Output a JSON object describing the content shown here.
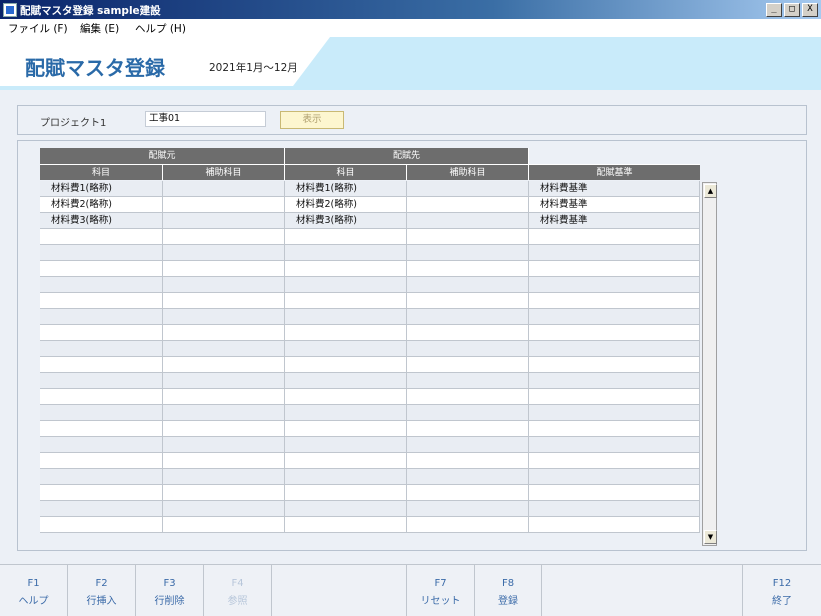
{
  "window": {
    "title": "配賦マスタ登録 sample建設",
    "buttons": [
      "_",
      "□",
      "X"
    ]
  },
  "menu": [
    {
      "label": "ファイル (F)"
    },
    {
      "label": "編集 (E)"
    },
    {
      "label": "ヘルプ (H)"
    }
  ],
  "header": {
    "title": "配賦マスタ登録",
    "period": "2021年1月～12月"
  },
  "filter": {
    "project_label": "プロジェクト1",
    "project_value": "工事01",
    "show_button": "表示"
  },
  "grid": {
    "group_headers": {
      "source": "配賦元",
      "dest": "配賦先"
    },
    "columns": [
      "科目",
      "補助科目",
      "科目",
      "補助科目",
      "配賦基準"
    ],
    "rows": [
      [
        "材料費1(略称)",
        "",
        "材料費1(略称)",
        "",
        "材料費基準"
      ],
      [
        "材料費2(略称)",
        "",
        "材料費2(略称)",
        "",
        "材料費基準"
      ],
      [
        "材料費3(略称)",
        "",
        "材料費3(略称)",
        "",
        "材料費基準"
      ],
      [
        "",
        "",
        "",
        "",
        ""
      ],
      [
        "",
        "",
        "",
        "",
        ""
      ],
      [
        "",
        "",
        "",
        "",
        ""
      ],
      [
        "",
        "",
        "",
        "",
        ""
      ],
      [
        "",
        "",
        "",
        "",
        ""
      ],
      [
        "",
        "",
        "",
        "",
        ""
      ],
      [
        "",
        "",
        "",
        "",
        ""
      ],
      [
        "",
        "",
        "",
        "",
        ""
      ],
      [
        "",
        "",
        "",
        "",
        ""
      ],
      [
        "",
        "",
        "",
        "",
        ""
      ],
      [
        "",
        "",
        "",
        "",
        ""
      ],
      [
        "",
        "",
        "",
        "",
        ""
      ],
      [
        "",
        "",
        "",
        "",
        ""
      ],
      [
        "",
        "",
        "",
        "",
        ""
      ],
      [
        "",
        "",
        "",
        "",
        ""
      ],
      [
        "",
        "",
        "",
        "",
        ""
      ],
      [
        "",
        "",
        "",
        "",
        ""
      ],
      [
        "",
        "",
        "",
        "",
        ""
      ],
      [
        "",
        "",
        "",
        "",
        ""
      ]
    ],
    "scroll_up": "▲",
    "scroll_down": "▼"
  },
  "fkeys": [
    {
      "key": "F1",
      "label": "ヘルプ",
      "enabled": true
    },
    {
      "key": "F2",
      "label": "行挿入",
      "enabled": true
    },
    {
      "key": "F3",
      "label": "行削除",
      "enabled": true
    },
    {
      "key": "F4",
      "label": "参照",
      "enabled": false
    },
    {
      "key": "",
      "label": "",
      "enabled": false
    },
    {
      "key": "F7",
      "label": "リセット",
      "enabled": true
    },
    {
      "key": "F8",
      "label": "登録",
      "enabled": true
    },
    {
      "key": "",
      "label": "",
      "enabled": false
    },
    {
      "key": "F12",
      "label": "終了",
      "enabled": true
    }
  ],
  "colors": {
    "header_blue": "#2a6aa8",
    "header_band": "#c9ebfa",
    "grid_header": "#6d6d6d",
    "row_alt": "#e9edf3"
  }
}
